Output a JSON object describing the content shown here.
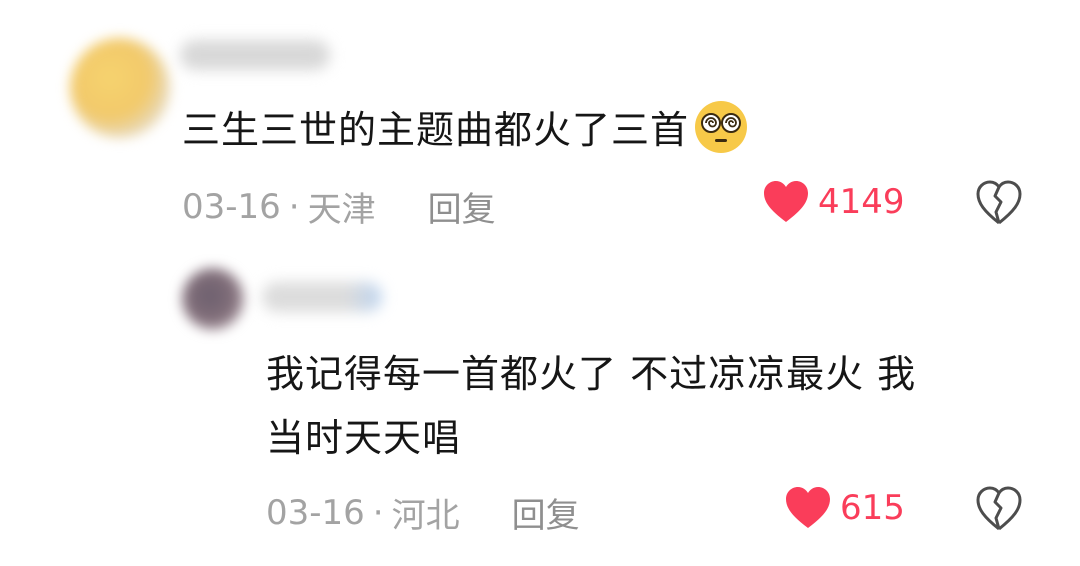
{
  "comments": [
    {
      "text": "三生三世的主题曲都火了三首",
      "emoji": "dizzy-face-emoji",
      "date": "03-16",
      "separator": "·",
      "location": "天津",
      "reply_label": "回复",
      "likes": "4149"
    },
    {
      "text_line1": "我记得每一首都火了 不过凉凉最火 我",
      "text_line2": "当时天天唱",
      "date": "03-16",
      "separator": "·",
      "location": "河北",
      "reply_label": "回复",
      "likes": "615"
    }
  ],
  "colors": {
    "like": "#fa3d5a",
    "meta": "#a3a3a3",
    "text": "#161616"
  }
}
